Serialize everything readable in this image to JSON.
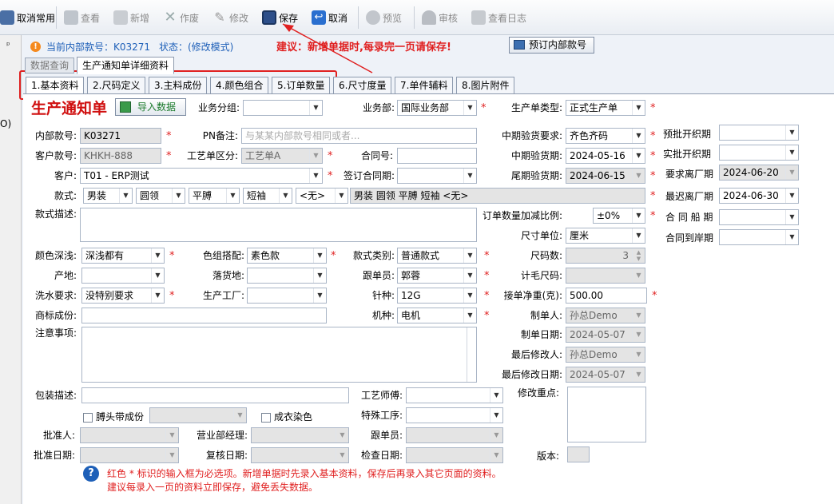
{
  "toolbar": {
    "cancel_common": "取消常用",
    "view": "查看",
    "add": "新增",
    "void": "作废",
    "edit": "修改",
    "save": "保存",
    "cancel": "取消",
    "preview": "预览",
    "audit": "审核",
    "view_log": "查看日志"
  },
  "status": {
    "internal_no_text": "当前内部款号：K03271",
    "state_text": "状态：(修改模式)",
    "advice": "建议：新增单据时,每录完一页请保存!",
    "reserve_button": "预订内部款号"
  },
  "left_strip": {
    "pin": "ᵖ",
    "clip": "O)"
  },
  "outer_tabs": [
    "数据查询",
    "生产通知单详细资料"
  ],
  "inner_tabs": [
    "1.基本资料",
    "2.尺码定义",
    "3.主料成份",
    "4.颜色组合",
    "5.订单数量",
    "6.尺寸度量",
    "7.单件辅料",
    "8.图片附件"
  ],
  "form_title": "生产通知单",
  "import_button": "导入数据",
  "fields": {
    "business_group": {
      "label": "业务分组:",
      "value": ""
    },
    "department": {
      "label": "业务部:",
      "value": "国际业务部"
    },
    "order_type": {
      "label": "生产单类型:",
      "value": "正式生产单"
    },
    "internal_no": {
      "label": "内部款号:",
      "value": "K03271"
    },
    "pn_note": {
      "label": "PN备注:",
      "placeholder": "与某某内部款号相同或者..."
    },
    "mid_check_req": {
      "label": "中期验货要求:",
      "value": "齐色齐码"
    },
    "pre_open": {
      "label": "预批开织期",
      "value": ""
    },
    "customer_no": {
      "label": "客户款号:",
      "value": "KHKH-888"
    },
    "craft_type": {
      "label": "工艺单区分:",
      "value": "工艺单A"
    },
    "contract_no": {
      "label": "合同号:",
      "value": ""
    },
    "mid_check_date": {
      "label": "中期验货期:",
      "value": "2024-05-16"
    },
    "actual_open": {
      "label": "实批开织期",
      "value": ""
    },
    "customer": {
      "label": "客户:",
      "value": "T01 - ERP测试"
    },
    "sign_date": {
      "label": "签订合同期:",
      "value": ""
    },
    "final_check_date": {
      "label": "尾期验货期:",
      "value": "2024-06-15"
    },
    "required_leave": {
      "label": "要求离厂期",
      "value": "2024-06-20"
    },
    "style": {
      "label": "款式:",
      "values": [
        "男装",
        "圆领",
        "平膊",
        "短袖",
        "<无>"
      ],
      "summary": "男装 圆领 平膊 短袖 <无>"
    },
    "latest_leave": {
      "label": "最迟离厂期",
      "value": "2024-06-30"
    },
    "style_desc": {
      "label": "款式描述:",
      "value": ""
    },
    "qty_ratio": {
      "label": "订单数量加减比例:",
      "value": "±0%"
    },
    "contract_ship": {
      "label": "合 同 船 期",
      "value": ""
    },
    "size_unit": {
      "label": "尺寸单位:",
      "value": "厘米"
    },
    "contract_arrive": {
      "label": "合同到岸期",
      "value": ""
    },
    "color_depth": {
      "label": "颜色深浅:",
      "value": "深浅都有"
    },
    "color_match": {
      "label": "色组搭配:",
      "value": "素色款"
    },
    "style_category": {
      "label": "款式类别:",
      "value": "普通款式"
    },
    "size_count": {
      "label": "尺码数:",
      "value": "3"
    },
    "origin": {
      "label": "产地:",
      "value": ""
    },
    "delivery_place": {
      "label": "落货地:",
      "value": ""
    },
    "follower": {
      "label": "跟单员:",
      "value": "郭蓉"
    },
    "weight_size": {
      "label": "计毛尺码:",
      "value": ""
    },
    "wash_req": {
      "label": "洗水要求:",
      "value": "没特别要求"
    },
    "factory": {
      "label": "生产工厂:",
      "value": ""
    },
    "needle": {
      "label": "针种:",
      "value": "12G"
    },
    "net_weight": {
      "label": "接单净重(克):",
      "value": "500.00"
    },
    "brand_comp": {
      "label": "商标成份:",
      "value": ""
    },
    "machine": {
      "label": "机种:",
      "value": "电机"
    },
    "maker": {
      "label": "制单人:",
      "value": "孙总Demo"
    },
    "notes": {
      "label": "注意事项:",
      "value": ""
    },
    "make_date": {
      "label": "制单日期:",
      "value": "2024-05-07"
    },
    "last_modifier": {
      "label": "最后修改人:",
      "value": "孙总Demo"
    },
    "last_modify_date": {
      "label": "最后修改日期:",
      "value": "2024-05-07"
    },
    "package_desc": {
      "label": "包装描述:",
      "value": ""
    },
    "craftsman": {
      "label": "工艺师傅:",
      "value": ""
    },
    "modify_focus": {
      "label": "修改重点:",
      "value": ""
    },
    "collar_check": {
      "label": "膊头带成份",
      "value": ""
    },
    "dye_check": {
      "label": "成衣染色"
    },
    "special_process": {
      "label": "特殊工序:",
      "value": ""
    },
    "approver": {
      "label": "批准人:",
      "value": ""
    },
    "sales_manager": {
      "label": "营业部经理:",
      "value": ""
    },
    "follower2": {
      "label": "跟单员:",
      "value": ""
    },
    "approve_date": {
      "label": "批准日期:",
      "value": ""
    },
    "review_date": {
      "label": "复核日期:",
      "value": ""
    },
    "check_date": {
      "label": "检查日期:",
      "value": ""
    },
    "version": {
      "label": "版本:",
      "value": ""
    }
  },
  "footer": {
    "line1": "红色 * 标识的输入框为必选项。新增单据时先录入基本资料，保存后再录入其它页面的资料。",
    "line2": "建议每录入一页的资料立即保存，避免丢失数据。"
  },
  "colors": {
    "accent": "#e02020",
    "title": "#d01010",
    "help_blue": "#1d5fb8"
  }
}
